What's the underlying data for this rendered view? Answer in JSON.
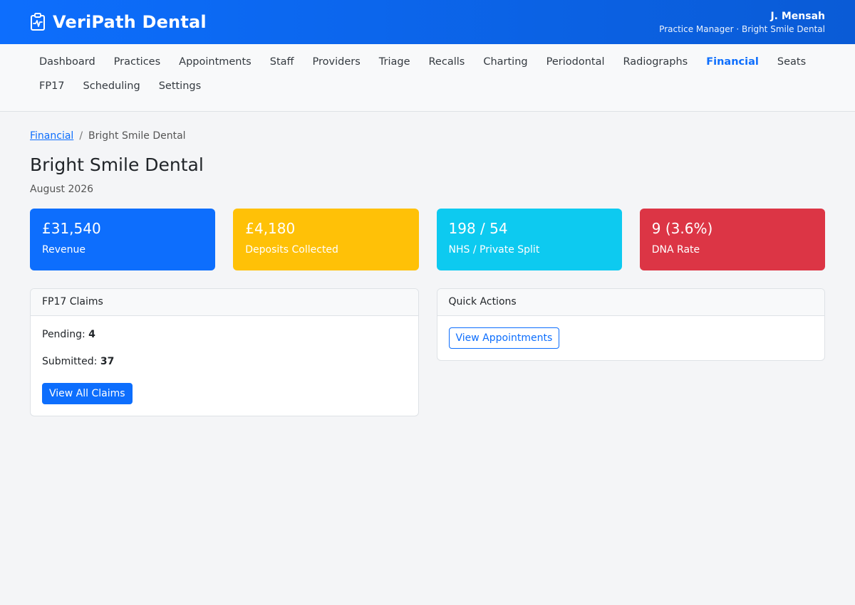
{
  "header": {
    "brand": "VeriPath Dental",
    "brand_icon": "clipboard-pulse-icon",
    "user_name": "J. Mensah",
    "user_role": "Practice Manager · Bright Smile Dental"
  },
  "nav": {
    "items": [
      {
        "label": "Dashboard",
        "active": false
      },
      {
        "label": "Practices",
        "active": false
      },
      {
        "label": "Appointments",
        "active": false
      },
      {
        "label": "Staff",
        "active": false
      },
      {
        "label": "Providers",
        "active": false
      },
      {
        "label": "Triage",
        "active": false
      },
      {
        "label": "Recalls",
        "active": false
      },
      {
        "label": "Charting",
        "active": false
      },
      {
        "label": "Periodontal",
        "active": false
      },
      {
        "label": "Radiographs",
        "active": false
      },
      {
        "label": "Financial",
        "active": true
      },
      {
        "label": "Seats",
        "active": false
      },
      {
        "label": "FP17",
        "active": false
      },
      {
        "label": "Scheduling",
        "active": false
      },
      {
        "label": "Settings",
        "active": false
      }
    ]
  },
  "breadcrumb": {
    "parent": "Financial",
    "separator": "/",
    "current": "Bright Smile Dental"
  },
  "page": {
    "title": "Bright Smile Dental",
    "subtitle": "August 2026"
  },
  "stats": [
    {
      "value": "£31,540",
      "label": "Revenue",
      "color": "#0d6efd"
    },
    {
      "value": "£4,180",
      "label": "Deposits Collected",
      "color": "#ffc107"
    },
    {
      "value": "198 / 54",
      "label": "NHS / Private Split",
      "color": "#0dcaf0"
    },
    {
      "value": "9 (3.6%)",
      "label": "DNA Rate",
      "color": "#dc3545"
    }
  ],
  "claims_panel": {
    "title": "FP17 Claims",
    "pending_label": "Pending:",
    "pending_value": "4",
    "submitted_label": "Submitted:",
    "submitted_value": "37",
    "button_label": "View All Claims"
  },
  "actions_panel": {
    "title": "Quick Actions",
    "button_label": "View Appointments"
  }
}
